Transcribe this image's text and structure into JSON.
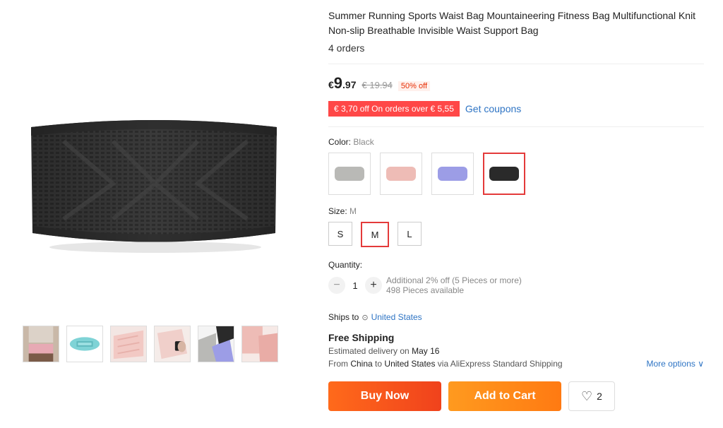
{
  "product": {
    "title": "Summer Running Sports Waist Bag Mountaineering Fitness Bag Multifunctional Knit Non-slip Breathable Invisible Waist Support Bag",
    "orders": "4 orders"
  },
  "price": {
    "currency": "€",
    "integer": "9",
    "decimal": ".97",
    "original": "€ 19.94",
    "discount": "50% off"
  },
  "coupon": {
    "tag": "€ 3,70 off On orders over € 5,55",
    "link": "Get coupons"
  },
  "color": {
    "label": "Color:",
    "selected": "Black",
    "swatches": [
      {
        "name": "gray",
        "hex": "#b9b9b6"
      },
      {
        "name": "pink",
        "hex": "#eebcb6"
      },
      {
        "name": "purple",
        "hex": "#9c9de6"
      },
      {
        "name": "black",
        "hex": "#2a2a2a"
      }
    ]
  },
  "size": {
    "label": "Size:",
    "selected": "M",
    "options": [
      "S",
      "M",
      "L"
    ]
  },
  "quantity": {
    "label": "Quantity:",
    "minus": "−",
    "value": "1",
    "plus": "+",
    "note1": "Additional 2% off (5 Pieces or more)",
    "note2": "498 Pieces available"
  },
  "shipping": {
    "ships_to_label": "Ships to",
    "pin_icon": "⊙",
    "country": "United States",
    "free": "Free Shipping",
    "est_prefix": "Estimated delivery on",
    "est_date": "May 16",
    "from_prefix": "From",
    "from_country": "China",
    "to_word": "to",
    "to_country": "United States",
    "via": "via AliExpress Standard Shipping",
    "more_options": "More options ∨"
  },
  "actions": {
    "buy_now": "Buy Now",
    "add_to_cart": "Add to Cart",
    "wish_count": "2",
    "heart_icon": "♡"
  },
  "colors": {
    "accent_red": "#e43a3a",
    "link_blue": "#2e74c4",
    "coupon_red": "#ff4747"
  }
}
